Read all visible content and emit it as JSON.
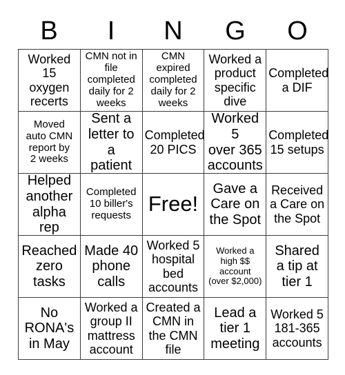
{
  "card": {
    "title": "BINGO",
    "header_letters": [
      "B",
      "I",
      "N",
      "G",
      "O"
    ],
    "colors": {
      "background": "#ffffff",
      "text": "#000000",
      "grid_line": "#3a3a3a"
    },
    "grid_size": "5x5",
    "free_space_index": 12,
    "cells": [
      {
        "text": "Worked\n15 oxygen\nrecerts",
        "size": "md"
      },
      {
        "text": "CMN not in\nfile\ncompleted\ndaily for 2\nweeks",
        "size": "sm"
      },
      {
        "text": "CMN expired\ncompleted\ndaily for 2\nweeks",
        "size": "sm"
      },
      {
        "text": "Worked a\nproduct\nspecific\ndive",
        "size": "md"
      },
      {
        "text": "Completed\na DIF",
        "size": "md"
      },
      {
        "text": "Moved\nauto CMN\nreport by\n2 weeks",
        "size": "sm"
      },
      {
        "text": "Sent a\nletter to a\npatient",
        "size": "lg"
      },
      {
        "text": "Completed\n20 PICS",
        "size": "md"
      },
      {
        "text": "Worked 5\nover 365\naccounts",
        "size": "lg"
      },
      {
        "text": "Completed\n15 setups",
        "size": "md"
      },
      {
        "text": "Helped\nanother\nalpha rep",
        "size": "lg"
      },
      {
        "text": "Completed\n10 biller's\nrequests",
        "size": "sm"
      },
      {
        "text": "Free!",
        "size": "xl"
      },
      {
        "text": "Gave a\nCare on\nthe Spot",
        "size": "lg"
      },
      {
        "text": "Received\na Care on\nthe Spot",
        "size": "md"
      },
      {
        "text": "Reached\nzero\ntasks",
        "size": "lg"
      },
      {
        "text": "Made 40\nphone\ncalls",
        "size": "lg"
      },
      {
        "text": "Worked 5\nhospital\nbed\naccounts",
        "size": "md"
      },
      {
        "text": "Worked a\nhigh $$\naccount\n(over $2,000)",
        "size": "xs"
      },
      {
        "text": "Shared\na tip at\ntier 1",
        "size": "lg"
      },
      {
        "text": "No\nRONA's\nin May",
        "size": "lg"
      },
      {
        "text": "Worked a\ngroup II\nmattress\naccount",
        "size": "md"
      },
      {
        "text": "Created a\nCMN in\nthe CMN\nfile",
        "size": "md"
      },
      {
        "text": "Lead a\ntier 1\nmeeting",
        "size": "lg"
      },
      {
        "text": "Worked 5\n181-365\naccounts",
        "size": "md"
      }
    ]
  }
}
